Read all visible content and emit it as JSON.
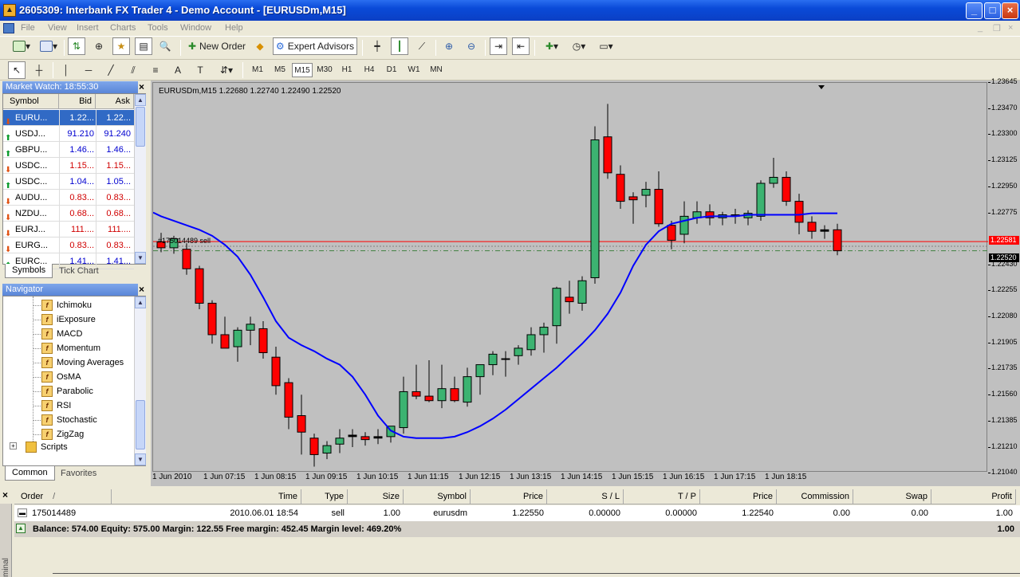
{
  "window": {
    "title": "2605309: Interbank FX Trader 4 - Demo Account - [EURUSDm,M15]"
  },
  "menu": [
    "File",
    "View",
    "Insert",
    "Charts",
    "Tools",
    "Window",
    "Help"
  ],
  "toolbar": {
    "new_order": "New Order",
    "expert_advisors": "Expert Advisors"
  },
  "timeframes": [
    "M1",
    "M5",
    "M15",
    "M30",
    "H1",
    "H4",
    "D1",
    "W1",
    "MN"
  ],
  "selected_timeframe": "M15",
  "market_watch": {
    "title": "Market Watch: 18:55:30",
    "headers": [
      "Symbol",
      "Bid",
      "Ask"
    ],
    "rows": [
      {
        "symbol": "EURU...",
        "bid": "1.22...",
        "ask": "1.22...",
        "dir": "down",
        "selected": true
      },
      {
        "symbol": "USDJ...",
        "bid": "91.210",
        "ask": "91.240",
        "dir": "up"
      },
      {
        "symbol": "GBPU...",
        "bid": "1.46...",
        "ask": "1.46...",
        "dir": "up"
      },
      {
        "symbol": "USDC...",
        "bid": "1.15...",
        "ask": "1.15...",
        "dir": "down"
      },
      {
        "symbol": "USDC...",
        "bid": "1.04...",
        "ask": "1.05...",
        "dir": "up"
      },
      {
        "symbol": "AUDU...",
        "bid": "0.83...",
        "ask": "0.83...",
        "dir": "down"
      },
      {
        "symbol": "NZDU...",
        "bid": "0.68...",
        "ask": "0.68...",
        "dir": "down"
      },
      {
        "symbol": "EURJ...",
        "bid": "111....",
        "ask": "111....",
        "dir": "down"
      },
      {
        "symbol": "EURG...",
        "bid": "0.83...",
        "ask": "0.83...",
        "dir": "down"
      },
      {
        "symbol": "EURC...",
        "bid": "1.41...",
        "ask": "1.41...",
        "dir": "up"
      }
    ],
    "tabs": [
      "Symbols",
      "Tick Chart"
    ]
  },
  "navigator": {
    "title": "Navigator",
    "items": [
      "Ichimoku",
      "iExposure",
      "MACD",
      "Momentum",
      "Moving Averages",
      "OsMA",
      "Parabolic",
      "RSI",
      "Stochastic",
      "ZigZag"
    ],
    "scripts": "Scripts",
    "tabs": [
      "Common",
      "Favorites"
    ]
  },
  "chart": {
    "info": "EURUSDm,M15  1.22680 1.22740 1.22490 1.22520",
    "order_label": "#175014489 sell",
    "price_labels": [
      "1.23645",
      "1.23470",
      "1.23300",
      "1.23125",
      "1.22950",
      "1.22775",
      "1.22430",
      "1.22255",
      "1.22080",
      "1.21905",
      "1.21735",
      "1.21560",
      "1.21385",
      "1.21210",
      "1.21040"
    ],
    "ask_tag": "1.22581",
    "bid_tag": "1.22520",
    "time_labels": [
      "1 Jun 2010",
      "1 Jun 07:15",
      "1 Jun 08:15",
      "1 Jun 09:15",
      "1 Jun 10:15",
      "1 Jun 11:15",
      "1 Jun 12:15",
      "1 Jun 13:15",
      "1 Jun 14:15",
      "1 Jun 15:15",
      "1 Jun 16:15",
      "1 Jun 17:15",
      "1 Jun 18:15"
    ],
    "colors": {
      "bull": "#3cb371",
      "bear": "#ff0000",
      "ma": "#0000ff",
      "bg": "#c0c0c0"
    }
  },
  "chart_data": {
    "type": "candlestick",
    "symbol": "EURUSDm",
    "timeframe": "M15",
    "ylim": [
      1.2104,
      1.2364
    ],
    "candles": [
      {
        "o": 1.2258,
        "h": 1.2264,
        "l": 1.2251,
        "c": 1.2254
      },
      {
        "o": 1.2254,
        "h": 1.2262,
        "l": 1.225,
        "c": 1.226
      },
      {
        "o": 1.2253,
        "h": 1.2257,
        "l": 1.2236,
        "c": 1.224
      },
      {
        "o": 1.224,
        "h": 1.2242,
        "l": 1.2213,
        "c": 1.2217
      },
      {
        "o": 1.2217,
        "h": 1.2219,
        "l": 1.219,
        "c": 1.2196
      },
      {
        "o": 1.2196,
        "h": 1.2208,
        "l": 1.2188,
        "c": 1.2187
      },
      {
        "o": 1.2188,
        "h": 1.2201,
        "l": 1.2178,
        "c": 1.2199
      },
      {
        "o": 1.2199,
        "h": 1.2208,
        "l": 1.2189,
        "c": 1.2203
      },
      {
        "o": 1.22,
        "h": 1.2205,
        "l": 1.218,
        "c": 1.2184
      },
      {
        "o": 1.2181,
        "h": 1.2188,
        "l": 1.2156,
        "c": 1.2162
      },
      {
        "o": 1.2164,
        "h": 1.2167,
        "l": 1.2133,
        "c": 1.2141
      },
      {
        "o": 1.2142,
        "h": 1.2156,
        "l": 1.2116,
        "c": 1.2131
      },
      {
        "o": 1.2127,
        "h": 1.213,
        "l": 1.2108,
        "c": 1.2116
      },
      {
        "o": 1.2117,
        "h": 1.2125,
        "l": 1.2113,
        "c": 1.2122
      },
      {
        "o": 1.2123,
        "h": 1.2133,
        "l": 1.2117,
        "c": 1.2127
      },
      {
        "o": 1.2129,
        "h": 1.2133,
        "l": 1.2121,
        "c": 1.2128
      },
      {
        "o": 1.2128,
        "h": 1.2131,
        "l": 1.2122,
        "c": 1.2126
      },
      {
        "o": 1.2127,
        "h": 1.2133,
        "l": 1.2123,
        "c": 1.2128
      },
      {
        "o": 1.2128,
        "h": 1.2135,
        "l": 1.2124,
        "c": 1.2135
      },
      {
        "o": 1.2134,
        "h": 1.2168,
        "l": 1.213,
        "c": 1.2158
      },
      {
        "o": 1.2158,
        "h": 1.2176,
        "l": 1.2153,
        "c": 1.2155
      },
      {
        "o": 1.2155,
        "h": 1.2179,
        "l": 1.2151,
        "c": 1.2152
      },
      {
        "o": 1.2152,
        "h": 1.2176,
        "l": 1.2147,
        "c": 1.216
      },
      {
        "o": 1.216,
        "h": 1.2168,
        "l": 1.2151,
        "c": 1.2152
      },
      {
        "o": 1.2151,
        "h": 1.2174,
        "l": 1.2148,
        "c": 1.2168
      },
      {
        "o": 1.2168,
        "h": 1.2176,
        "l": 1.2156,
        "c": 1.2176
      },
      {
        "o": 1.2176,
        "h": 1.2185,
        "l": 1.2169,
        "c": 1.2183
      },
      {
        "o": 1.218,
        "h": 1.2185,
        "l": 1.2168,
        "c": 1.218
      },
      {
        "o": 1.2182,
        "h": 1.2189,
        "l": 1.2176,
        "c": 1.2187
      },
      {
        "o": 1.2186,
        "h": 1.2201,
        "l": 1.2182,
        "c": 1.2196
      },
      {
        "o": 1.2196,
        "h": 1.2204,
        "l": 1.2184,
        "c": 1.2201
      },
      {
        "o": 1.2202,
        "h": 1.2228,
        "l": 1.219,
        "c": 1.2227
      },
      {
        "o": 1.2221,
        "h": 1.2232,
        "l": 1.221,
        "c": 1.2218
      },
      {
        "o": 1.2217,
        "h": 1.2235,
        "l": 1.2212,
        "c": 1.2232
      },
      {
        "o": 1.2234,
        "h": 1.2335,
        "l": 1.223,
        "c": 1.2326
      },
      {
        "o": 1.2328,
        "h": 1.235,
        "l": 1.23,
        "c": 1.2304
      },
      {
        "o": 1.2303,
        "h": 1.2309,
        "l": 1.228,
        "c": 1.2285
      },
      {
        "o": 1.2288,
        "h": 1.2291,
        "l": 1.227,
        "c": 1.2286
      },
      {
        "o": 1.2289,
        "h": 1.2298,
        "l": 1.2281,
        "c": 1.2293
      },
      {
        "o": 1.2293,
        "h": 1.2305,
        "l": 1.2268,
        "c": 1.227
      },
      {
        "o": 1.2269,
        "h": 1.2272,
        "l": 1.2253,
        "c": 1.2259
      },
      {
        "o": 1.2263,
        "h": 1.2285,
        "l": 1.2257,
        "c": 1.2275
      },
      {
        "o": 1.2274,
        "h": 1.2285,
        "l": 1.227,
        "c": 1.2278
      },
      {
        "o": 1.2278,
        "h": 1.2283,
        "l": 1.2269,
        "c": 1.2274
      },
      {
        "o": 1.2274,
        "h": 1.2278,
        "l": 1.2269,
        "c": 1.2276
      },
      {
        "o": 1.2276,
        "h": 1.228,
        "l": 1.227,
        "c": 1.2275
      },
      {
        "o": 1.2274,
        "h": 1.2279,
        "l": 1.2269,
        "c": 1.2277
      },
      {
        "o": 1.2275,
        "h": 1.2299,
        "l": 1.2272,
        "c": 1.2297
      },
      {
        "o": 1.2297,
        "h": 1.2314,
        "l": 1.2294,
        "c": 1.2301
      },
      {
        "o": 1.2301,
        "h": 1.2305,
        "l": 1.2282,
        "c": 1.2285
      },
      {
        "o": 1.2285,
        "h": 1.229,
        "l": 1.2263,
        "c": 1.2271
      },
      {
        "o": 1.2271,
        "h": 1.2275,
        "l": 1.226,
        "c": 1.2265
      },
      {
        "o": 1.2265,
        "h": 1.2269,
        "l": 1.226,
        "c": 1.2266
      },
      {
        "o": 1.2266,
        "h": 1.227,
        "l": 1.2249,
        "c": 1.2252
      }
    ],
    "moving_average": [
      1.2275,
      1.2272,
      1.2269,
      1.2266,
      1.2262,
      1.2256,
      1.2248,
      1.2236,
      1.2221,
      1.2205,
      1.2194,
      1.2189,
      1.2185,
      1.218,
      1.2176,
      1.2168,
      1.2156,
      1.2142,
      1.2132,
      1.2128,
      1.2127,
      1.2127,
      1.2127,
      1.2128,
      1.2131,
      1.2135,
      1.214,
      1.2146,
      1.2153,
      1.216,
      1.2167,
      1.2174,
      1.2182,
      1.219,
      1.2199,
      1.221,
      1.2224,
      1.2242,
      1.2256,
      1.2265,
      1.227,
      1.2272,
      1.2274,
      1.2275,
      1.2275,
      1.2275,
      1.2276,
      1.2276,
      1.2276,
      1.2276,
      1.2276,
      1.2277,
      1.2277,
      1.2277
    ],
    "ask_line": 1.22581,
    "bid_line": 1.2252
  },
  "terminal": {
    "headers": [
      "Order",
      "Time",
      "Type",
      "Size",
      "Symbol",
      "Price",
      "S / L",
      "T / P",
      "Price",
      "Commission",
      "Swap",
      "Profit"
    ],
    "order_sort_mark": "/",
    "row": {
      "order": "175014489",
      "time": "2010.06.01 18:54",
      "type": "sell",
      "size": "1.00",
      "symbol": "eurusdm",
      "price": "1.22550",
      "sl": "0.00000",
      "tp": "0.00000",
      "cur_price": "1.22540",
      "commission": "0.00",
      "swap": "0.00",
      "profit": "1.00"
    },
    "balance_line": "Balance: 574.00  Equity: 575.00  Margin: 122.55  Free margin: 452.45  Margin level: 469.20%",
    "total_profit": "1.00",
    "side_label": "minal"
  }
}
